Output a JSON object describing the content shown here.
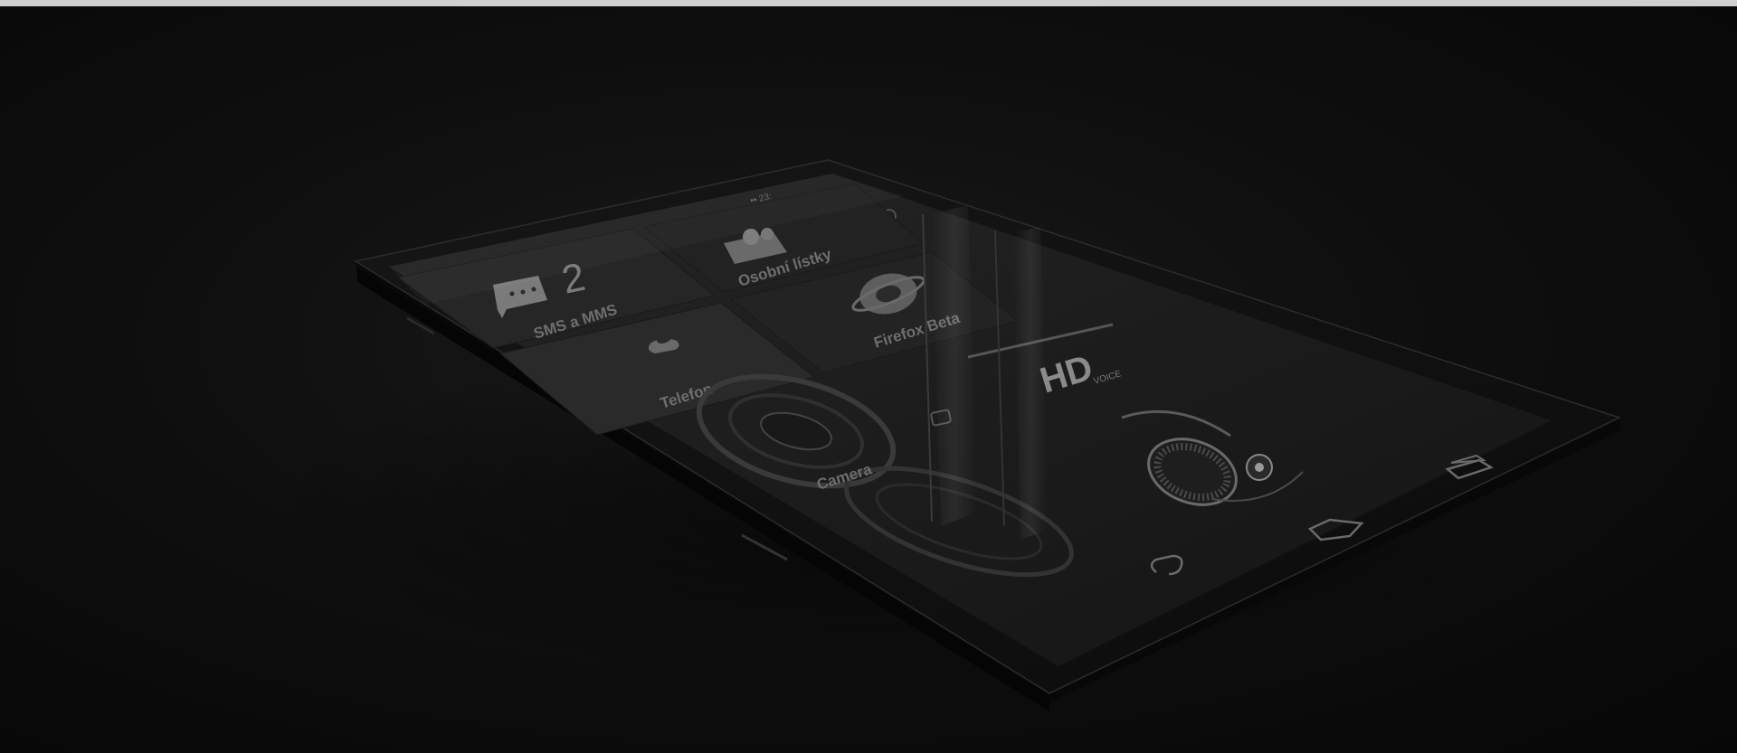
{
  "screen": {
    "status_signal": "•••••",
    "status_time": "▪▪ 23:",
    "tiles": {
      "sms": {
        "label": "SMS a MMS",
        "count": "2",
        "icon": "message-bubble-icon"
      },
      "contacts": {
        "label": "Osobní lístky",
        "icon": "people-icon"
      },
      "phone": {
        "label": "Telefon",
        "icon": "phone-handset-icon"
      },
      "firefox": {
        "label": "Firefox Beta",
        "icon": "browser-logo-icon"
      },
      "camera": {
        "label": "Camera",
        "icon": "camera-icon"
      }
    },
    "hd_badge": {
      "text": "HD",
      "sub": "VOICE"
    },
    "nav": {
      "back": "back-arrow-icon",
      "home": "home-icon",
      "recents": "recent-apps-icon"
    }
  },
  "colors": {
    "background": "#0a0a0a",
    "top_strip": "#cfcfcf",
    "phone_body": "#111111",
    "screen": "#1c1c1c"
  }
}
